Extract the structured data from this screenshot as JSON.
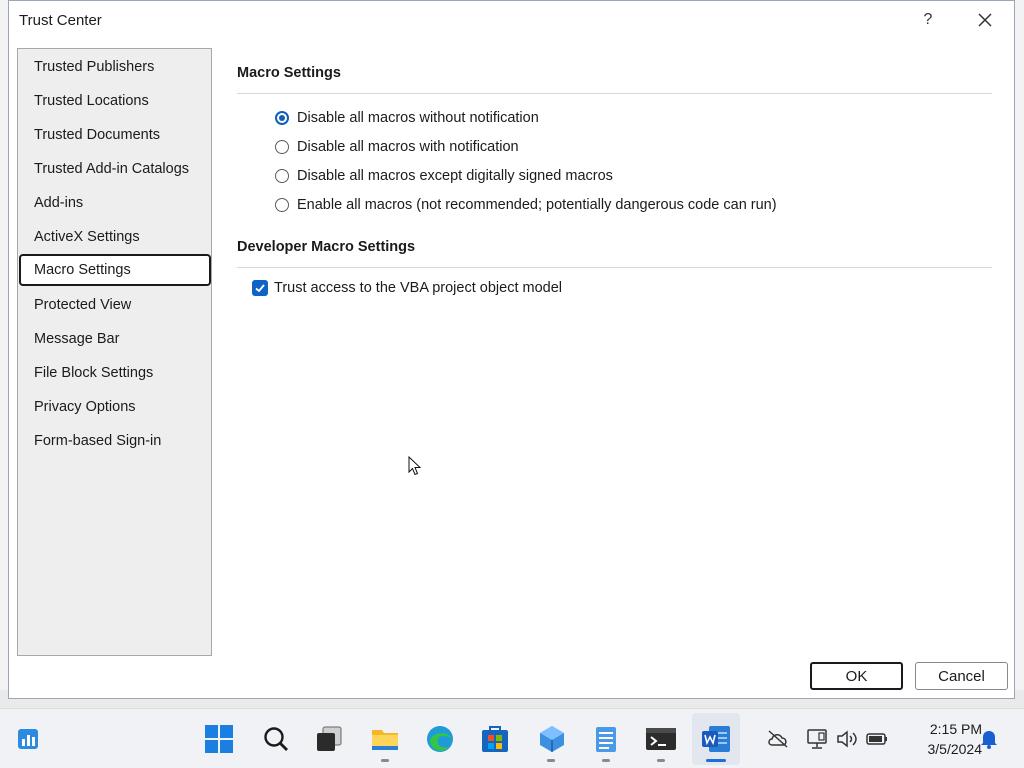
{
  "dialog": {
    "title": "Trust Center",
    "help_label": "?"
  },
  "nav": {
    "items": [
      {
        "label": "Trusted Publishers"
      },
      {
        "label": "Trusted Locations"
      },
      {
        "label": "Trusted Documents"
      },
      {
        "label": "Trusted Add-in Catalogs"
      },
      {
        "label": "Add-ins"
      },
      {
        "label": "ActiveX Settings"
      },
      {
        "label": "Macro Settings",
        "selected": true
      },
      {
        "label": "Protected View"
      },
      {
        "label": "Message Bar"
      },
      {
        "label": "File Block Settings"
      },
      {
        "label": "Privacy Options"
      },
      {
        "label": "Form-based Sign-in"
      }
    ]
  },
  "macro_settings": {
    "title": "Macro Settings",
    "options": [
      {
        "label": "Disable all macros without notification",
        "checked": true
      },
      {
        "label": "Disable all macros with notification",
        "checked": false
      },
      {
        "label": "Disable all macros except digitally signed macros",
        "checked": false
      },
      {
        "label": "Enable all macros (not recommended; potentially dangerous code can run)",
        "checked": false
      }
    ]
  },
  "developer_settings": {
    "title": "Developer Macro Settings",
    "trust_vba": {
      "label": "Trust access to the VBA project object model",
      "checked": true
    }
  },
  "buttons": {
    "ok": "OK",
    "cancel": "Cancel"
  },
  "taskbar": {
    "icons": [
      "widgets-icon",
      "start-icon",
      "search-icon",
      "task-view-icon",
      "file-explorer-icon",
      "edge-icon",
      "store-icon",
      "app-icon",
      "notepad-icon",
      "terminal-icon",
      "word-icon"
    ],
    "time": "2:15 PM",
    "date": "3/5/2024"
  },
  "colors": {
    "accent": "#0f5fb8",
    "checkbox": "#1063c6"
  }
}
